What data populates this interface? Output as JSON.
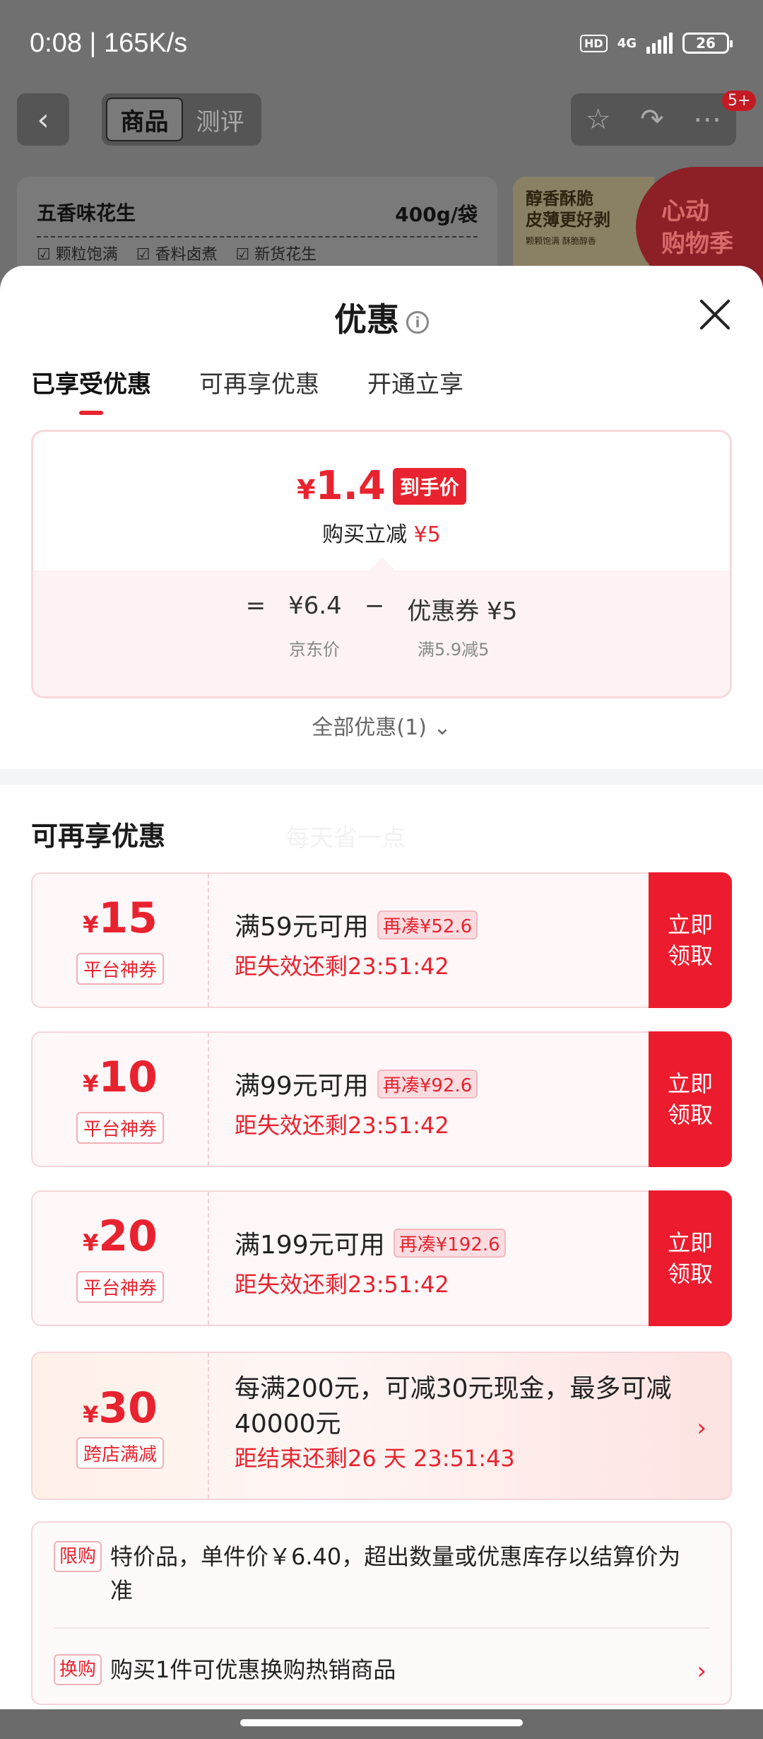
{
  "status_bar": {
    "time": "0:08 | 165K/s",
    "hd": "HD",
    "network": "4G",
    "battery": "26"
  },
  "header": {
    "tabs": [
      "商品",
      "测评"
    ],
    "badge": "5+"
  },
  "product": {
    "name": "五香味花生",
    "size": "400g/袋",
    "tags": [
      "颗粒饱满",
      "香料卤煮",
      "新货花生"
    ]
  },
  "promo_banner": {
    "line1": "醇香酥脆",
    "line2": "皮薄更好剥",
    "small": "颗颗饱满 酥脆醇香",
    "red_line1": "心动",
    "red_line2": "购物季"
  },
  "modal": {
    "title": "优惠",
    "tabs": [
      "已享受优惠",
      "可再享优惠",
      "开通立享"
    ],
    "price": {
      "currency": "¥",
      "final": "1.4",
      "final_tag": "到手价",
      "sub_label": "购买立减",
      "sub_value": "¥5",
      "formula_eq": "=",
      "formula_price": "¥6.4",
      "formula_minus": "−",
      "formula_coupon": "优惠券 ¥5",
      "label_price": "京东价",
      "label_coupon": "满5.9减5"
    },
    "all_offers": "全部优惠(1)",
    "section_title": "可再享优惠",
    "watermark": "每天省一点",
    "coupons": [
      {
        "amount": "15",
        "tag": "平台神券",
        "condition": "满59元可用",
        "need": "再凑¥52.6",
        "timer": "距失效还剩23:51:42",
        "btn_line1": "立即",
        "btn_line2": "领取"
      },
      {
        "amount": "10",
        "tag": "平台神券",
        "condition": "满99元可用",
        "need": "再凑¥92.6",
        "timer": "距失效还剩23:51:42",
        "btn_line1": "立即",
        "btn_line2": "领取"
      },
      {
        "amount": "20",
        "tag": "平台神券",
        "condition": "满199元可用",
        "need": "再凑¥192.6",
        "timer": "距失效还剩23:51:42",
        "btn_line1": "立即",
        "btn_line2": "领取"
      }
    ],
    "cross_store": {
      "amount": "30",
      "tag": "跨店满减",
      "text": "每满200元，可减30元现金，最多可减40000元",
      "timer": "距结束还剩26 天 23:51:43"
    },
    "rules": [
      {
        "tag": "限购",
        "text": "特价品，单件价￥6.40，超出数量或优惠库存以结算价为准"
      },
      {
        "tag": "换购",
        "text": "购买1件可优惠换购热销商品"
      }
    ]
  },
  "colors": {
    "accent": "#e8232f",
    "button": "#ec1c2e"
  }
}
